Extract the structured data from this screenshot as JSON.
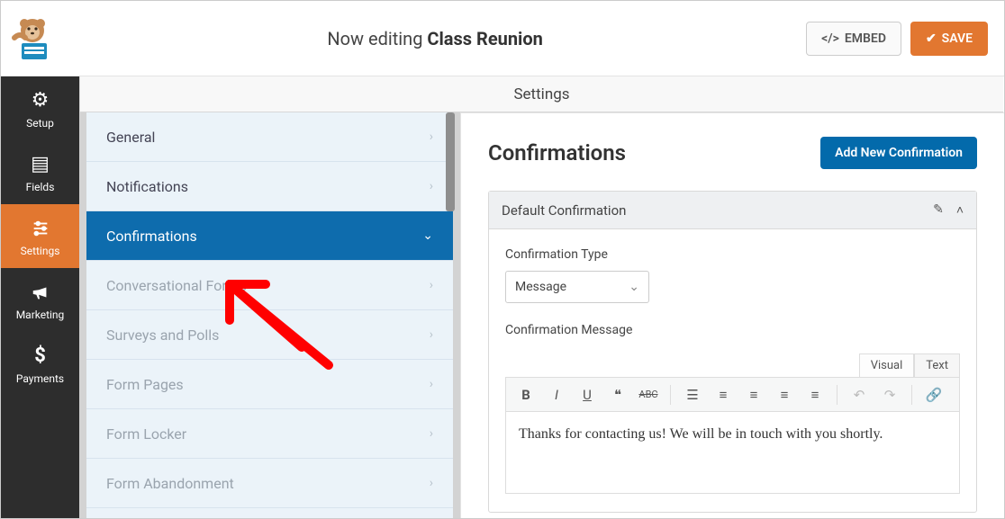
{
  "header": {
    "editing_prefix": "Now editing",
    "form_name": "Class Reunion",
    "embed_label": "EMBED",
    "save_label": "SAVE"
  },
  "sidenav": {
    "items": [
      {
        "icon": "gear",
        "label": "Setup"
      },
      {
        "icon": "list",
        "label": "Fields"
      },
      {
        "icon": "sliders",
        "label": "Settings"
      },
      {
        "icon": "bullhorn",
        "label": "Marketing"
      },
      {
        "icon": "dollar",
        "label": "Payments"
      }
    ],
    "active_index": 2
  },
  "settings_pane": {
    "title": "Settings",
    "items": [
      {
        "label": "General"
      },
      {
        "label": "Notifications"
      },
      {
        "label": "Confirmations",
        "active": true
      },
      {
        "label": "Conversational Forms",
        "muted": true
      },
      {
        "label": "Surveys and Polls",
        "muted": true
      },
      {
        "label": "Form Pages",
        "muted": true
      },
      {
        "label": "Form Locker",
        "muted": true
      },
      {
        "label": "Form Abandonment",
        "muted": true
      }
    ]
  },
  "content": {
    "heading": "Confirmations",
    "add_button": "Add New Confirmation",
    "panel_title": "Default Confirmation",
    "type_label": "Confirmation Type",
    "type_value": "Message",
    "message_label": "Confirmation Message",
    "tabs": {
      "visual": "Visual",
      "text": "Text"
    },
    "message_body": "Thanks for contacting us! We will be in touch with you shortly."
  }
}
